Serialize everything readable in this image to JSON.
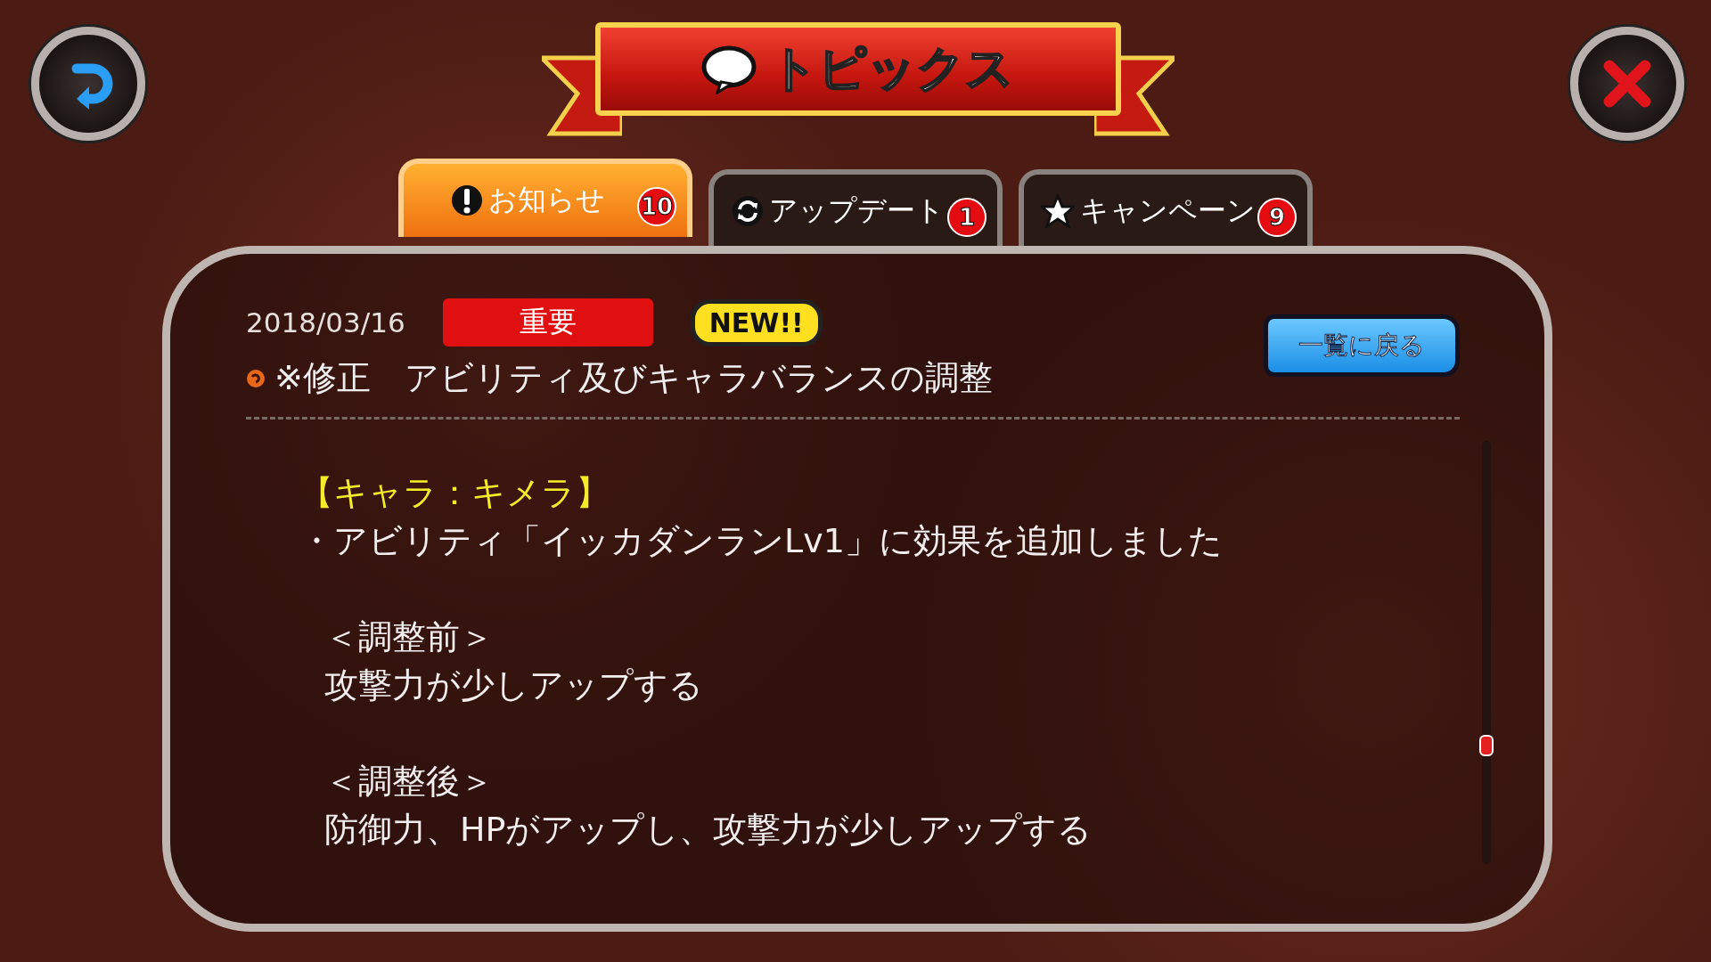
{
  "title": "トピックス",
  "tabs": [
    {
      "kind": "notice",
      "label": "お知らせ",
      "badge": "10",
      "selected": true
    },
    {
      "kind": "update",
      "label": "アップデート",
      "badge": "1",
      "selected": false
    },
    {
      "kind": "campaign",
      "label": "キャンペーン",
      "badge": "9",
      "selected": false
    }
  ],
  "article": {
    "date": "2018/03/16",
    "tag": "重要",
    "new_badge": "NEW!!",
    "title": "※修正　アビリティ及びキャラバランスの調整",
    "back_button": "一覧に戻る",
    "body": [
      {
        "kind": "normal",
        "lines": [
          {
            "kind": "heading",
            "text": "【キャラ：キメラ】"
          },
          {
            "kind": "plain",
            "text": "・アビリティ「イッカダンランLv1」に効果を追加しました"
          }
        ]
      },
      {
        "kind": "indented",
        "lines": [
          {
            "kind": "plain",
            "text": "＜調整前＞"
          },
          {
            "kind": "plain",
            "text": "攻撃力が少しアップする"
          }
        ]
      },
      {
        "kind": "indented",
        "lines": [
          {
            "kind": "plain",
            "text": "＜調整後＞"
          },
          {
            "kind": "plain",
            "text": "防御力、HPがアップし、攻撃力が少しアップする"
          }
        ]
      }
    ]
  }
}
